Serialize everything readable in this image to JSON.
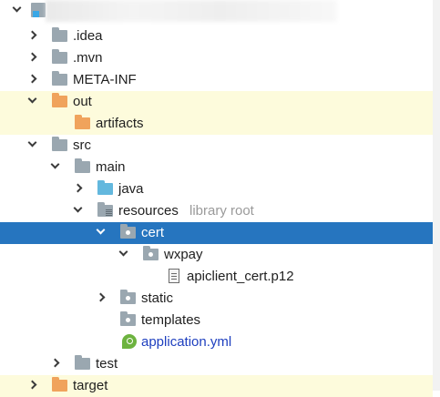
{
  "tree": {
    "root": {
      "label": ""
    },
    "items": [
      {
        "label": ".idea"
      },
      {
        "label": ".mvn"
      },
      {
        "label": "META-INF"
      },
      {
        "label": "out"
      },
      {
        "label": "artifacts"
      },
      {
        "label": "src"
      },
      {
        "label": "main"
      },
      {
        "label": "java"
      },
      {
        "label": "resources",
        "hint": "library root"
      },
      {
        "label": "cert"
      },
      {
        "label": "wxpay"
      },
      {
        "label": "apiclient_cert.p12"
      },
      {
        "label": "static"
      },
      {
        "label": "templates"
      },
      {
        "label": "application.yml"
      },
      {
        "label": "test"
      },
      {
        "label": "target"
      }
    ]
  },
  "colors": {
    "selection": "#2675bf",
    "excluded_highlight": "#fdfbdc",
    "folder_gray": "#9aa7b0",
    "folder_orange": "#f0a35c",
    "folder_blue": "#63b8de",
    "config_file_text": "#1e3fbf"
  },
  "icons": {
    "project": "module-icon",
    "folder": "folder-icon",
    "excluded_folder": "excluded-folder-icon",
    "source_folder": "source-folder-icon",
    "resource_folder": "resources-folder-icon",
    "package": "package-icon",
    "file": "file-icon",
    "spring_config": "spring-config-icon"
  }
}
